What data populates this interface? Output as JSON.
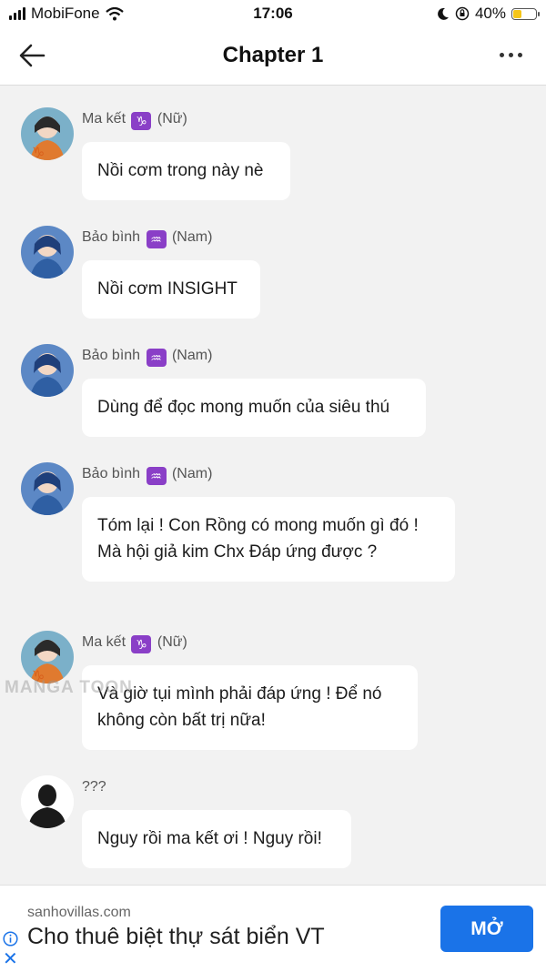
{
  "status_bar": {
    "carrier": "MobiFone",
    "time": "17:06",
    "battery_percent": "40%",
    "battery_level": 0.4,
    "icons": [
      "signal-icon",
      "wifi-icon",
      "moon-icon",
      "orientation-lock-icon",
      "battery-icon"
    ]
  },
  "header": {
    "title": "Chapter 1",
    "back_icon": "arrow-left-icon",
    "more_icon": "more-horizontal-icon"
  },
  "messages": [
    {
      "name": "Ma kết",
      "sign": "♑",
      "gender": "(Nữ)",
      "text": "Nồi cơm trong này nè",
      "avatar": "capricorn"
    },
    {
      "name": "Bảo bình",
      "sign": "♒",
      "gender": "(Nam)",
      "text": "Nồi cơm INSIGHT",
      "avatar": "aquarius"
    },
    {
      "name": "Bảo bình",
      "sign": "♒",
      "gender": "(Nam)",
      "text": "Dùng để đọc mong muốn của siêu thú",
      "avatar": "aquarius"
    },
    {
      "name": "Bảo bình",
      "sign": "♒",
      "gender": "(Nam)",
      "text_line1": "Tóm lại ! Con Rồng có mong muốn gì đó !",
      "text_line2": "Mà hội giả kim Chx Đáp ứng được ?",
      "avatar": "aquarius"
    },
    {
      "name": "Ma kết",
      "sign": "♑",
      "gender": "(Nữ)",
      "text_line1": "Và giờ tụi mình phải đáp ứng ! Để nó",
      "text_line2": "không còn bất trị nữa!",
      "avatar": "capricorn"
    },
    {
      "name": "???",
      "text": "Nguy rồi ma kết ơi ! Nguy rồi!",
      "avatar": "unknown-silhouette"
    }
  ],
  "watermark": "MANGA TOON",
  "ad": {
    "domain": "sanhovillas.com",
    "headline": "Cho thuê biệt thự sát biển VT",
    "button": "MỞ",
    "info_icon": "info-icon",
    "close_icon": "close-icon"
  },
  "colors": {
    "background": "#f2f2f2",
    "bubble": "#ffffff",
    "zodiac_badge": "#8a3fc7",
    "ad_button": "#1a73e8"
  }
}
